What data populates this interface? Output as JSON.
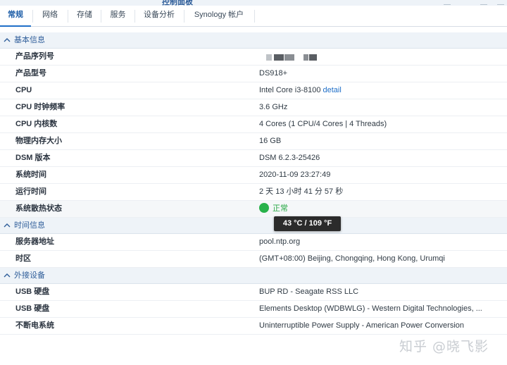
{
  "window": {
    "title_fragment": "控制面板"
  },
  "tabs": [
    {
      "label": "常规",
      "active": true
    },
    {
      "label": "网络"
    },
    {
      "label": "存储"
    },
    {
      "label": "服务"
    },
    {
      "label": "设备分析"
    },
    {
      "label": "Synology 帐户"
    }
  ],
  "sections": {
    "basic": {
      "title": "基本信息",
      "rows": [
        {
          "key": "产品序列号",
          "value": ""
        },
        {
          "key": "产品型号",
          "value": "DS918+"
        },
        {
          "key": "CPU",
          "value": "Intel Core i3-8100",
          "link": "detail"
        },
        {
          "key": "CPU 时钟频率",
          "value": "3.6 GHz"
        },
        {
          "key": "CPU 内核数",
          "value": "4 Cores (1 CPU/4 Cores | 4 Threads)"
        },
        {
          "key": "物理内存大小",
          "value": "16 GB"
        },
        {
          "key": "DSM 版本",
          "value": "DSM 6.2.3-25426"
        },
        {
          "key": "系统时间",
          "value": "2020-11-09 23:27:49"
        },
        {
          "key": "运行时间",
          "value": "2 天 13 小时 41 分 57 秒"
        },
        {
          "key": "系统散热状态",
          "value": "正常"
        }
      ]
    },
    "time": {
      "title": "时间信息",
      "rows": [
        {
          "key": "服务器地址",
          "value": "pool.ntp.org"
        },
        {
          "key": "时区",
          "value": "(GMT+08:00) Beijing, Chongqing, Hong Kong, Urumqi"
        }
      ]
    },
    "external": {
      "title": "外接设备",
      "rows": [
        {
          "key": "USB 硬盘",
          "value": "BUP RD - Seagate RSS LLC"
        },
        {
          "key": "USB 硬盘",
          "value": "Elements Desktop (WDBWLG) - Western Digital Technologies, ..."
        },
        {
          "key": "不断电系统",
          "value": "Uninterruptible Power Supply - American Power Conversion"
        }
      ]
    }
  },
  "tooltip": {
    "text": "43 °C / 109 °F"
  },
  "watermark": "知乎 @晓飞影",
  "colors": {
    "accent": "#1f6fc8",
    "status_ok": "#28b24b",
    "section_bg": "#eef3f8"
  }
}
